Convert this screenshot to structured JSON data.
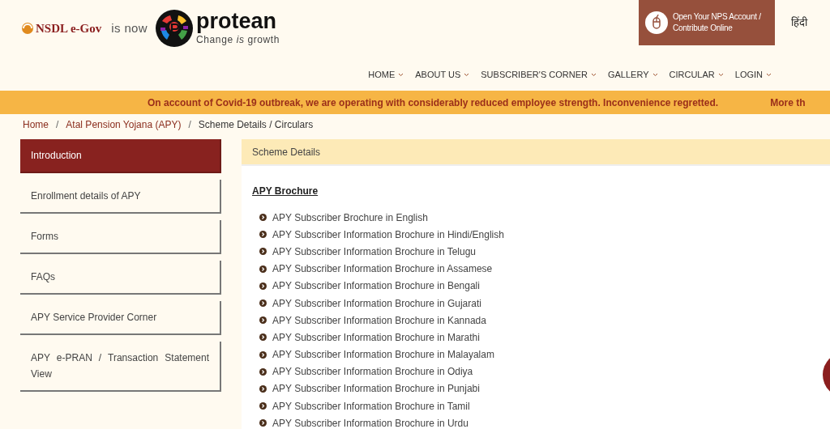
{
  "header": {
    "old_brand": "NSDL e-Gov",
    "connector": "is now",
    "brand": "protean",
    "tagline": "Change *is* growth",
    "cta": "Open Your NPS Account / Contribute Online",
    "language": "हिंदी"
  },
  "nav": [
    {
      "label": "HOME"
    },
    {
      "label": "ABOUT US"
    },
    {
      "label": "SUBSCRIBER'S CORNER"
    },
    {
      "label": "GALLERY"
    },
    {
      "label": "CIRCULAR"
    },
    {
      "label": "LOGIN"
    }
  ],
  "notice": [
    "On account of Covid-19 outbreak, we are operating with considerably reduced employee strength. Inconvenience regretted.",
    "More th"
  ],
  "breadcrumb": [
    {
      "kind": "link",
      "label": "Home"
    },
    {
      "kind": "separator",
      "label": "/"
    },
    {
      "kind": "link",
      "label": "Atal Pension Yojana (APY)"
    },
    {
      "kind": "separator",
      "label": "/"
    },
    {
      "kind": "current",
      "label": "Scheme Details / Circulars"
    }
  ],
  "sidebar": {
    "items": [
      {
        "label": "Introduction",
        "selected": true
      },
      {
        "label": "Enrollment details of APY",
        "selected": false
      },
      {
        "label": "Forms",
        "selected": false
      },
      {
        "label": "FAQs",
        "selected": false
      },
      {
        "label": "APY Service Provider Corner",
        "selected": false
      },
      {
        "label": "APY e-PRAN / Transaction Statement View",
        "selected": false
      }
    ]
  },
  "panel": {
    "title": "Scheme Details",
    "section": "APY Brochure",
    "links": [
      "APY Subscriber Brochure in English",
      "APY Subscriber Information Brochure in Hindi/English",
      "APY Subscriber Information Brochure in Telugu",
      "APY Subscriber Information Brochure in Assamese",
      "APY Subscriber Information Brochure in Bengali",
      "APY Subscriber Information Brochure in Gujarati",
      "APY Subscriber Information Brochure in Kannada",
      "APY Subscriber Information Brochure in Marathi",
      "APY Subscriber Information Brochure in Malayalam",
      "APY Subscriber Information Brochure in Odiya",
      "APY Subscriber Information Brochure in Punjabi",
      "APY Subscriber Information Brochure in Tamil",
      "APY Subscriber Information Brochure in Urdu"
    ]
  }
}
